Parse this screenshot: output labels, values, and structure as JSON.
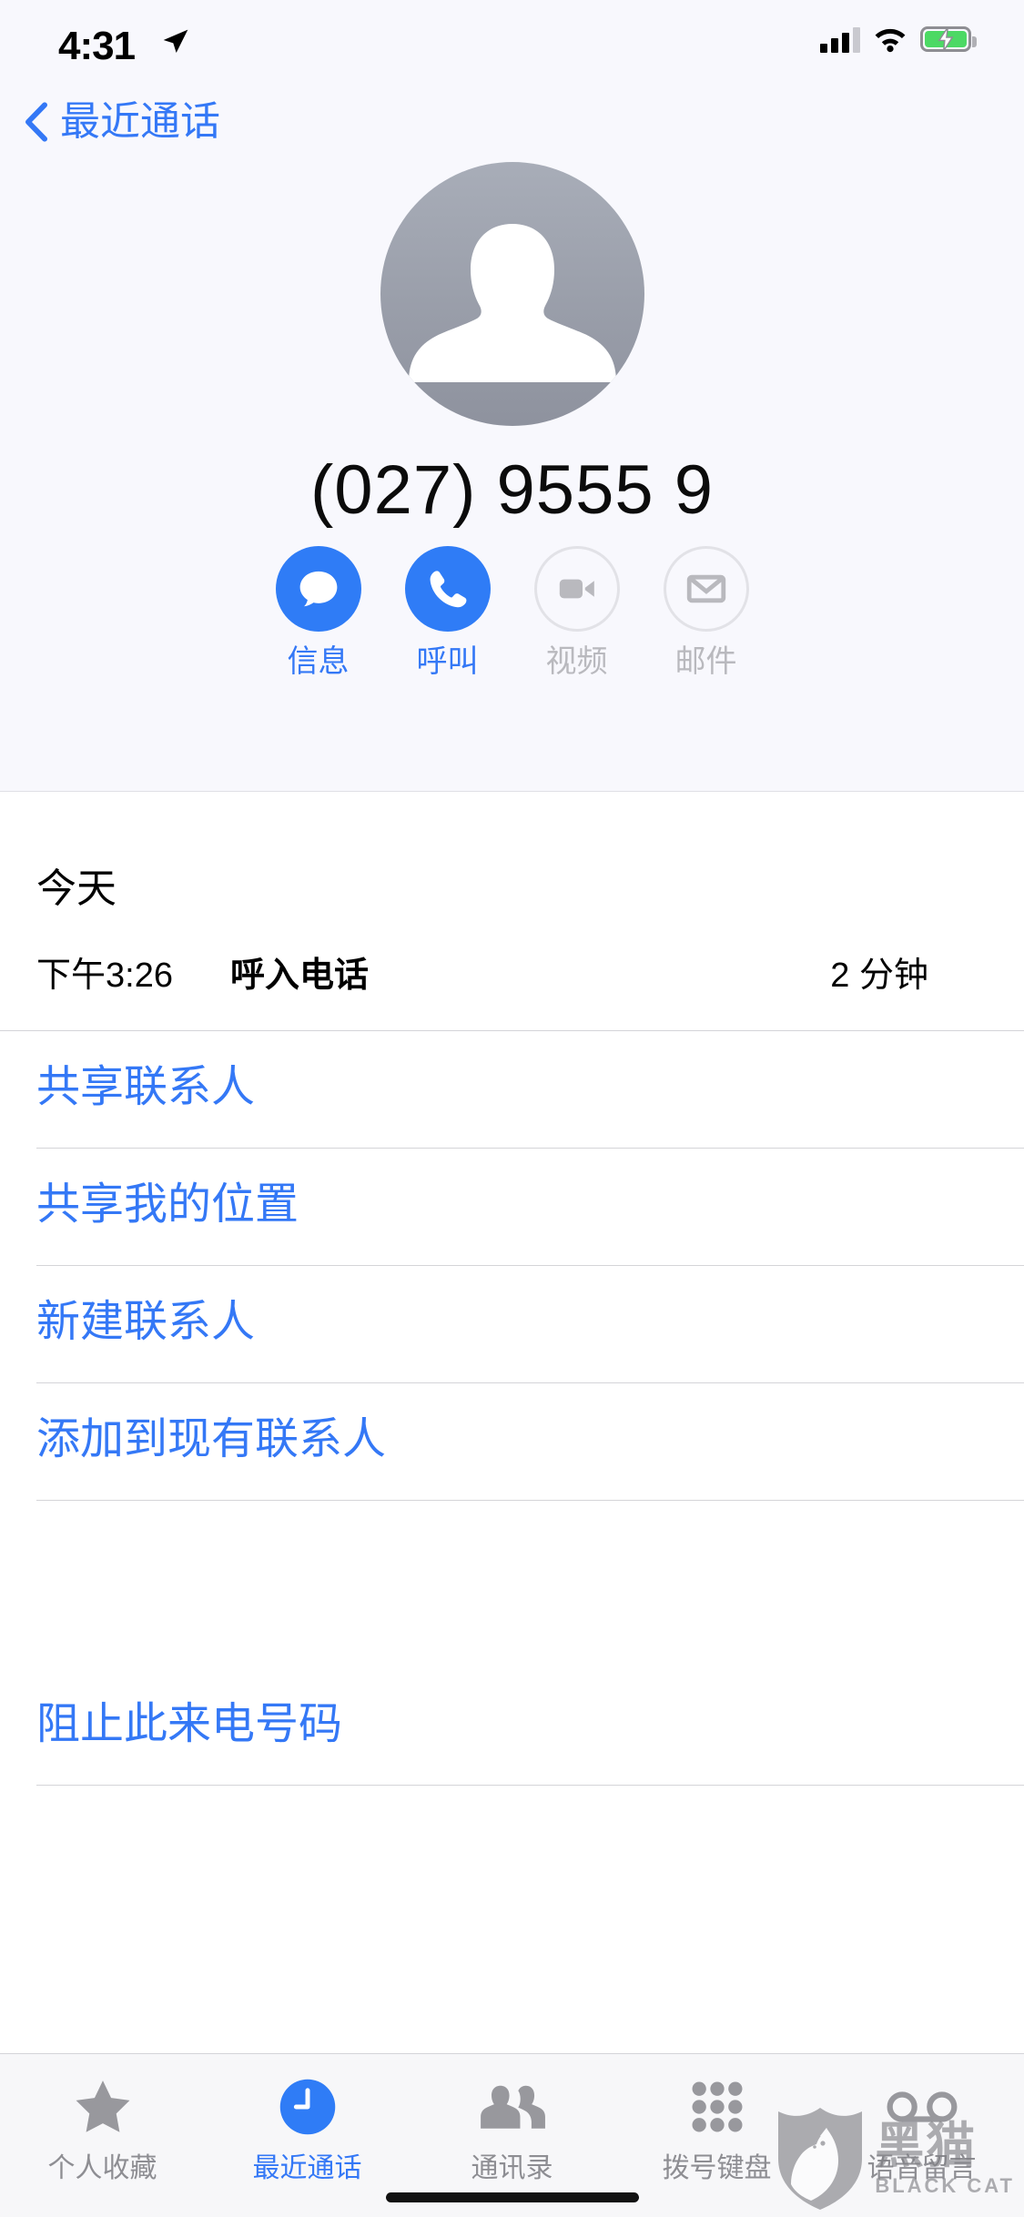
{
  "status_bar": {
    "time": "4:31",
    "location_icon": "location-arrow-icon",
    "signal_icon": "cellular-signal-icon",
    "wifi_icon": "wifi-icon",
    "battery_icon": "battery-charging-icon",
    "battery_color": "#4cd964"
  },
  "nav": {
    "back_icon": "chevron-left-icon",
    "back_label": "最近通话"
  },
  "header": {
    "avatar_icon": "person-placeholder-avatar",
    "phone_number": "(027) 9555 9",
    "accent_color": "#3478f6",
    "actions": [
      {
        "label": "信息",
        "icon": "message-bubble-icon",
        "enabled": true
      },
      {
        "label": "呼叫",
        "icon": "phone-handset-icon",
        "enabled": true
      },
      {
        "label": "视频",
        "icon": "video-camera-icon",
        "enabled": false
      },
      {
        "label": "邮件",
        "icon": "envelope-icon",
        "enabled": false
      }
    ]
  },
  "call_log": {
    "day_label": "今天",
    "entry": {
      "time": "下午3:26",
      "kind": "呼入电话",
      "duration": "2 分钟"
    }
  },
  "action_list": [
    {
      "label": "共享联系人"
    },
    {
      "label": "共享我的位置"
    },
    {
      "label": "新建联系人"
    },
    {
      "label": "添加到现有联系人"
    }
  ],
  "block_list": [
    {
      "label": "阻止此来电号码"
    }
  ],
  "tab_bar": [
    {
      "label": "个人收藏",
      "icon": "star-icon",
      "active": false
    },
    {
      "label": "最近通话",
      "icon": "clock-icon",
      "active": true
    },
    {
      "label": "通讯录",
      "icon": "contacts-icon",
      "active": false
    },
    {
      "label": "拨号键盘",
      "icon": "keypad-icon",
      "active": false
    },
    {
      "label": "语音留言",
      "icon": "voicemail-icon",
      "active": false
    }
  ],
  "watermark": {
    "logo_icon": "black-cat-shield-logo",
    "cn": "黑猫",
    "en": "BLACK CAT"
  }
}
